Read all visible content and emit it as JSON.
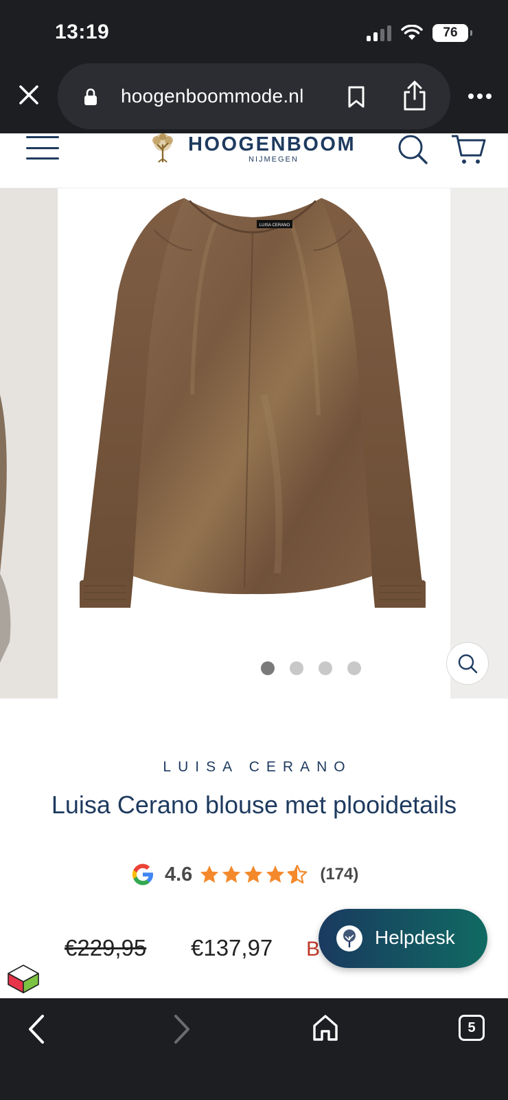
{
  "status_bar": {
    "time": "13:19",
    "battery": "76",
    "icons": [
      "signal-icon",
      "wifi-icon",
      "battery-icon"
    ]
  },
  "browser": {
    "url": "hoogenboommode.nl",
    "icons": [
      "close-icon",
      "lock-icon",
      "bookmark-icon",
      "share-icon",
      "more-icon"
    ]
  },
  "site": {
    "logo_name": "HOOGENBOOM",
    "logo_sub": "NIJMEGEN",
    "icons": [
      "menu-icon",
      "tree-logo-icon",
      "search-icon",
      "cart-icon"
    ]
  },
  "gallery": {
    "image_count": 4,
    "active_index": 0,
    "blouse_color": "#7d5d43",
    "label_text": "LUISA CERANO"
  },
  "product": {
    "brand": "LUISA CERANO",
    "title": "Luisa Cerano blouse met plooidetails",
    "rating_value": "4.6",
    "rating_stars": 4.6,
    "rating_count": "(174)",
    "price_old": "€229,95",
    "price_new": "€137,97",
    "price_badge": "B"
  },
  "helpdesk": {
    "label": "Helpdesk"
  },
  "browser_nav": {
    "tab_count": "5",
    "icons": [
      "back-icon",
      "forward-icon",
      "home-icon",
      "tabs-icon"
    ]
  },
  "colors": {
    "browser_chrome": "#1d1e22",
    "brand_navy": "#1e3a5f",
    "star_orange": "#f4892b",
    "sale_red": "#c0392b",
    "helpdesk_gradient_start": "#1a3a60",
    "helpdesk_gradient_end": "#106a62"
  }
}
